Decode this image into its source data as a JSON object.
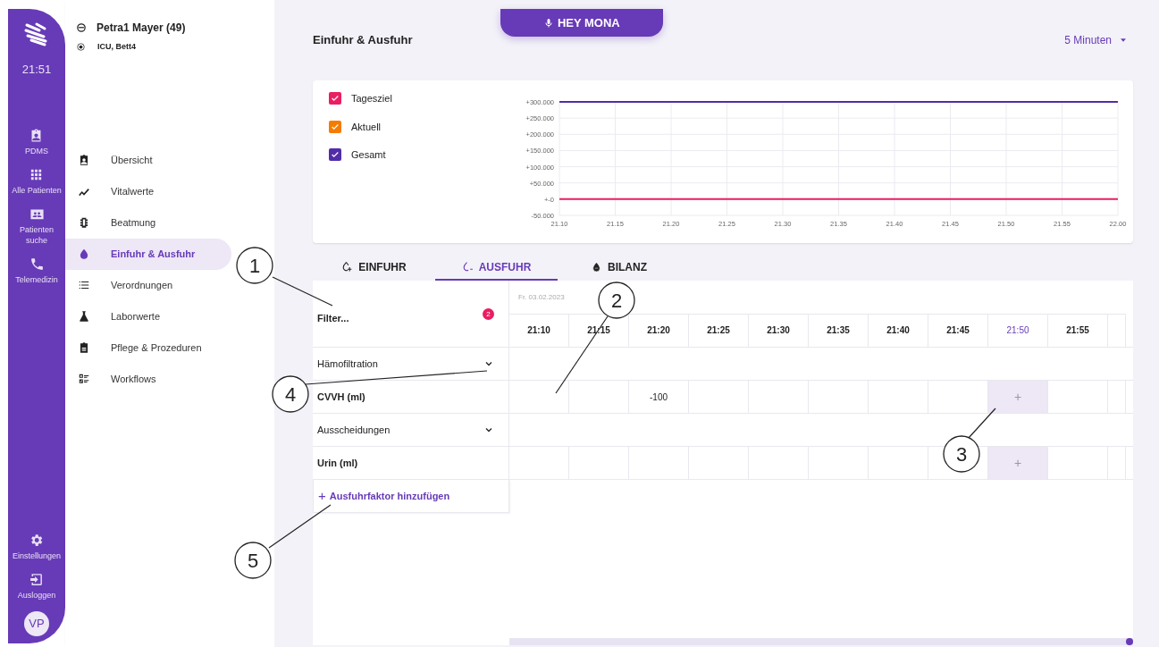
{
  "rail": {
    "time": "21:51",
    "items": [
      {
        "label": "PDMS"
      },
      {
        "label": "Alle Patienten"
      },
      {
        "label": "Patienten suche"
      },
      {
        "label": "Telemedizin"
      }
    ],
    "bottom_items": [
      {
        "label": "Einstellungen"
      },
      {
        "label": "Ausloggen"
      }
    ],
    "avatar": "VP"
  },
  "patient": {
    "name": "Petra1 Mayer (49)",
    "location": "ICU, Bett4"
  },
  "nav": [
    {
      "label": "Übersicht",
      "selected": false
    },
    {
      "label": "Vitalwerte",
      "selected": false
    },
    {
      "label": "Beatmung",
      "selected": false
    },
    {
      "label": "Einfuhr & Ausfuhr",
      "selected": true
    },
    {
      "label": "Verordnungen",
      "selected": false
    },
    {
      "label": "Laborwerte",
      "selected": false
    },
    {
      "label": "Pflege & Prozeduren",
      "selected": false
    },
    {
      "label": "Workflows",
      "selected": false
    }
  ],
  "voice_button": "HEY MONA",
  "page_title": "Einfuhr & Ausfuhr",
  "interval": "5 Minuten",
  "legend": [
    {
      "checked": true
    },
    {
      "checked": true
    },
    {
      "checked": true
    }
  ],
  "chart_data": {
    "type": "line",
    "categories": [
      "21.10",
      "21.15",
      "21.20",
      "21.25",
      "21.30",
      "21.35",
      "21.40",
      "21.45",
      "21.50",
      "21.55",
      "22.00"
    ],
    "ylim": [
      -50,
      300
    ],
    "grid": true,
    "yticks": [
      {
        "value": 300,
        "label": "+300.000"
      },
      {
        "value": 250,
        "label": "+250.000"
      },
      {
        "value": 200,
        "label": "+200.000"
      },
      {
        "value": 150,
        "label": "+150.000"
      },
      {
        "value": 100,
        "label": "+100.000"
      },
      {
        "value": 50,
        "label": "+50.000"
      },
      {
        "value": 0,
        "label": "+-0"
      },
      {
        "value": -50,
        "label": "-50.000"
      }
    ],
    "series": [
      {
        "name": "Tagesziel",
        "color": "#e91e63",
        "values": [
          0,
          0,
          0,
          0,
          0,
          0,
          0,
          0,
          0,
          0,
          0
        ]
      },
      {
        "name": "Aktuell",
        "color": "#f57c00",
        "values": [
          null,
          null,
          null,
          null,
          null,
          null,
          null,
          null,
          null,
          null,
          null
        ]
      },
      {
        "name": "Gesamt",
        "color": "#512da8",
        "values": [
          300,
          300,
          300,
          300,
          300,
          300,
          300,
          300,
          300,
          300,
          300
        ]
      }
    ]
  },
  "tabs": [
    {
      "label": "EINFUHR",
      "selected": false
    },
    {
      "label": "AUSFUHR",
      "selected": true
    },
    {
      "label": "BILANZ",
      "selected": false
    }
  ],
  "grid": {
    "filter": "Filter...",
    "filter_count": "2",
    "date": "Fr. 03.02.2023",
    "times": [
      {
        "label": "21:10",
        "current": false
      },
      {
        "label": "21:15",
        "current": false
      },
      {
        "label": "21:20",
        "current": false
      },
      {
        "label": "21:25",
        "current": false
      },
      {
        "label": "21:30",
        "current": false
      },
      {
        "label": "21:35",
        "current": false
      },
      {
        "label": "21:40",
        "current": false
      },
      {
        "label": "21:45",
        "current": false
      },
      {
        "label": "21:50",
        "current": true
      },
      {
        "label": "21:55",
        "current": false
      }
    ],
    "groups": [
      {
        "label": "Hämofiltration",
        "expanded": true,
        "rows": [
          {
            "label": "CVVH (ml)",
            "cells": [
              {
                "kind": "empty"
              },
              {
                "kind": "empty"
              },
              {
                "kind": "value",
                "text": "-100"
              },
              {
                "kind": "empty"
              },
              {
                "kind": "empty"
              },
              {
                "kind": "empty"
              },
              {
                "kind": "empty"
              },
              {
                "kind": "empty"
              },
              {
                "kind": "add",
                "text": "+"
              },
              {
                "kind": "empty"
              }
            ]
          }
        ]
      },
      {
        "label": "Ausscheidungen",
        "expanded": true,
        "rows": [
          {
            "label": "Urin (ml)",
            "cells": [
              {
                "kind": "empty"
              },
              {
                "kind": "empty"
              },
              {
                "kind": "empty"
              },
              {
                "kind": "empty"
              },
              {
                "kind": "empty"
              },
              {
                "kind": "empty"
              },
              {
                "kind": "empty"
              },
              {
                "kind": "empty"
              },
              {
                "kind": "add",
                "text": "+"
              },
              {
                "kind": "empty"
              }
            ]
          }
        ]
      }
    ],
    "add_factor": {
      "icon": "+",
      "label": "Ausfuhrfaktor hinzufügen"
    }
  },
  "callouts": [
    {
      "number": "1"
    },
    {
      "number": "2"
    },
    {
      "number": "3"
    },
    {
      "number": "4"
    },
    {
      "number": "5"
    }
  ]
}
